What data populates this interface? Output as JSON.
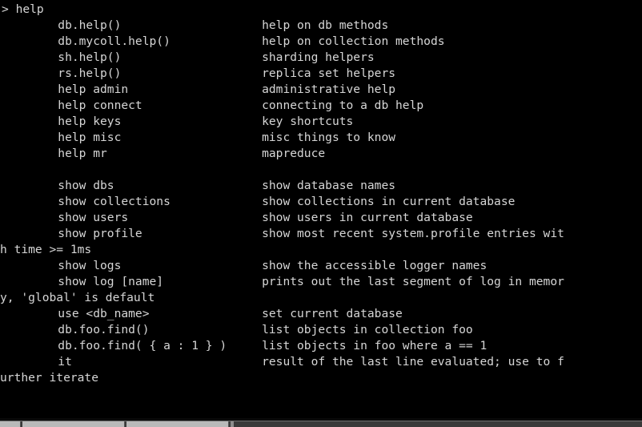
{
  "terminal": {
    "title": "mongo shell",
    "colors": {
      "background": "#000000",
      "foreground": "#d6d6d6",
      "taskbar_face": "#b9b9b9",
      "taskbar_frame": "#3a3a3a"
    },
    "columns": 80,
    "prompt_symbol": ">",
    "command_entered": "help",
    "prompt_line": "> help",
    "lines": [
      "> help",
      "        db.help()                    help on db methods",
      "        db.mycoll.help()             help on collection methods",
      "        sh.help()                    sharding helpers",
      "        rs.help()                    replica set helpers",
      "        help admin                   administrative help",
      "        help connect                 connecting to a db help",
      "        help keys                    key shortcuts",
      "        help misc                    misc things to know",
      "        help mr                      mapreduce",
      "",
      "        show dbs                     show database names",
      "        show collections             show collections in current database",
      "        show users                   show users in current database",
      "        show profile                 show most recent system.profile entries wit",
      "h time >= 1ms",
      "        show logs                    show the accessible logger names",
      "        show log [name]              prints out the last segment of log in memor",
      "y, 'global' is default",
      "        use <db_name>                set current database",
      "        db.foo.find()                list objects in collection foo",
      "        db.foo.find( { a : 1 } )     list objects in foo where a == 1",
      "        it                           result of the last line evaluated; use to f",
      "urther iterate"
    ],
    "help_entries": [
      {
        "command": "db.help()",
        "description": "help on db methods"
      },
      {
        "command": "db.mycoll.help()",
        "description": "help on collection methods"
      },
      {
        "command": "sh.help()",
        "description": "sharding helpers"
      },
      {
        "command": "rs.help()",
        "description": "replica set helpers"
      },
      {
        "command": "help admin",
        "description": "administrative help"
      },
      {
        "command": "help connect",
        "description": "connecting to a db help"
      },
      {
        "command": "help keys",
        "description": "key shortcuts"
      },
      {
        "command": "help misc",
        "description": "misc things to know"
      },
      {
        "command": "help mr",
        "description": "mapreduce"
      },
      {
        "command": "show dbs",
        "description": "show database names"
      },
      {
        "command": "show collections",
        "description": "show collections in current database"
      },
      {
        "command": "show users",
        "description": "show users in current database"
      },
      {
        "command": "show profile",
        "description": "show most recent system.profile entries with time >= 1ms"
      },
      {
        "command": "show logs",
        "description": "show the accessible logger names"
      },
      {
        "command": "show log [name]",
        "description": "prints out the last segment of log in memory, 'global' is default"
      },
      {
        "command": "use <db_name>",
        "description": "set current database"
      },
      {
        "command": "db.foo.find()",
        "description": "list objects in collection foo"
      },
      {
        "command": "db.foo.find( { a : 1 } )",
        "description": "list objects in foo where a == 1"
      },
      {
        "command": "it",
        "description": "result of the last line evaluated; use to further iterate"
      }
    ]
  },
  "taskbar": {
    "visible": true,
    "note": "partially visible window-list taskbar at bottom edge"
  }
}
